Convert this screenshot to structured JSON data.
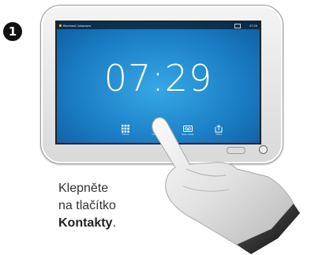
{
  "step": "1",
  "status_bar": {
    "user_name": "Bernhard Johansen",
    "time": "07:29"
  },
  "clock": "07:29",
  "dock": [
    {
      "icon": "keypad-icon",
      "label": "Řízení"
    },
    {
      "icon": "contact-icon",
      "label": "Kontakty"
    },
    {
      "icon": "voicemail-icon",
      "label": "Hlas. pošta"
    },
    {
      "icon": "share-icon",
      "label": "Sdílet"
    }
  ],
  "caption": {
    "line1": "Klepněte",
    "line2": "na tlačítko",
    "bold": "Kontakty",
    "suffix": "."
  }
}
